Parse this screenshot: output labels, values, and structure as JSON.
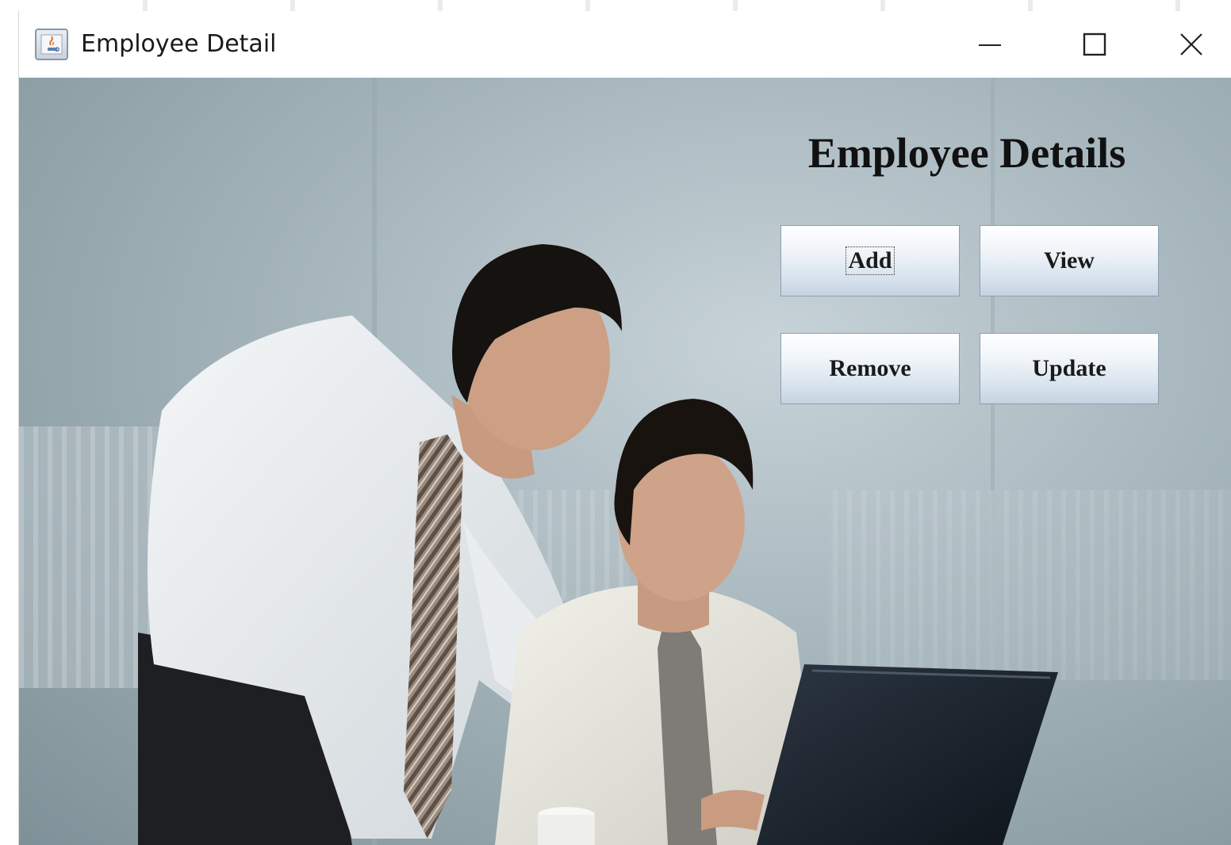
{
  "window": {
    "title": "Employee Detail",
    "app_icon": "java-icon",
    "controls": {
      "minimize_icon": "minimize-icon",
      "maximize_icon": "maximize-icon",
      "close_icon": "close-icon"
    }
  },
  "main": {
    "heading": "Employee Details",
    "buttons": {
      "add": "Add",
      "view": "View",
      "remove": "Remove",
      "update": "Update"
    },
    "focused_button": "add",
    "background_image": "office-photo-two-employees-at-laptop"
  },
  "colors": {
    "titlebar": "#ffffff",
    "heading": "#111111",
    "button_top": "#ffffff",
    "button_bottom": "#c5d3e1"
  }
}
